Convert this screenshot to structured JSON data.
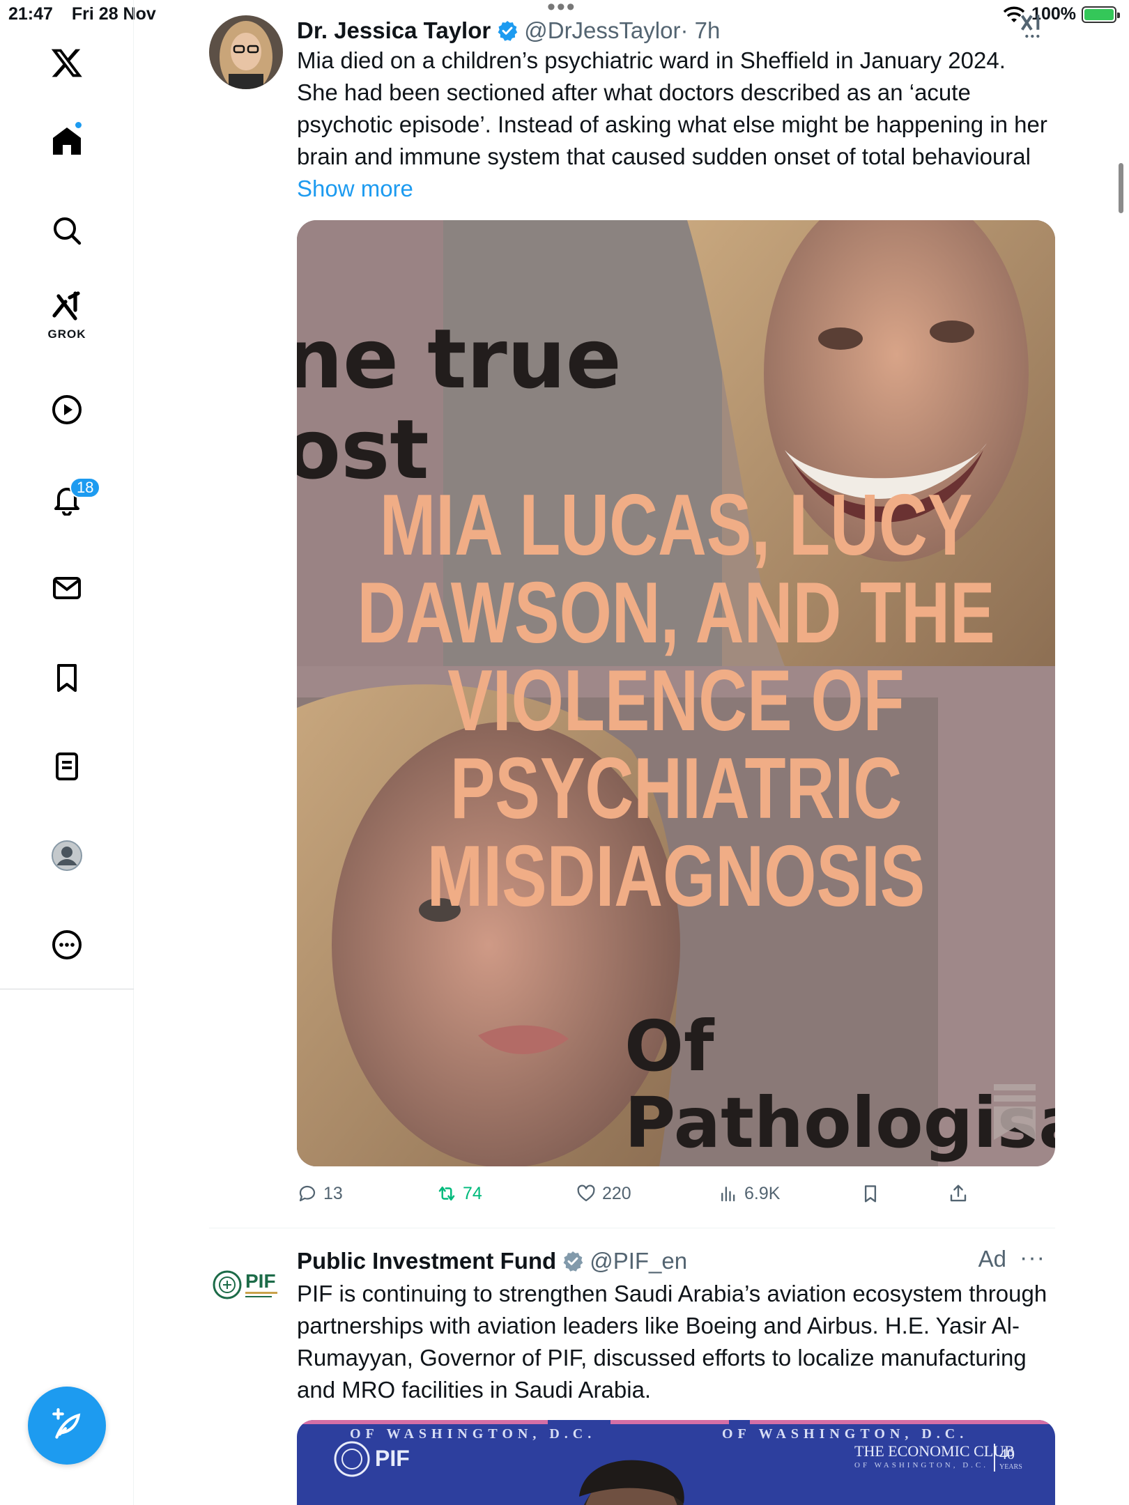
{
  "status_bar": {
    "time": "21:47",
    "date": "Fri 28 Nov",
    "battery": "100%"
  },
  "sidebar": {
    "items": [
      {
        "name": "x-logo",
        "label": ""
      },
      {
        "name": "home",
        "label": ""
      },
      {
        "name": "search",
        "label": ""
      },
      {
        "name": "grok",
        "label": "GROK"
      },
      {
        "name": "videos",
        "label": ""
      },
      {
        "name": "notifications",
        "label": ""
      },
      {
        "name": "messages",
        "label": ""
      },
      {
        "name": "bookmarks",
        "label": ""
      },
      {
        "name": "lists",
        "label": ""
      },
      {
        "name": "profile",
        "label": ""
      },
      {
        "name": "more",
        "label": ""
      }
    ],
    "notification_count": "18"
  },
  "tweets": [
    {
      "name": "Dr. Jessica Taylor",
      "handle": "@DrJessTaylor",
      "time": "· 7h",
      "text": "Mia died on a children’s psychiatric ward in Sheffield in January 2024. She had been sectioned after what doctors described as an ‘acute psychotic episode’. Instead of asking what else might be happening in her brain and immune system that caused sudden onset of total behavioural ",
      "show_more": "Show more",
      "media": {
        "bg_text_1": "ne true",
        "bg_text_2": "ost",
        "headline_lines": [
          "MIA LUCAS, LUCY",
          "DAWSON, AND THE",
          "VIOLENCE OF",
          "PSYCHIATRIC",
          "MISDIAGNOSIS"
        ],
        "bg_text_3": "Of",
        "bg_text_4": "Pathologisat"
      },
      "stats": {
        "replies": "13",
        "reposts": "74",
        "likes": "220",
        "views": "6.9K"
      }
    },
    {
      "name": "Public Investment Fund",
      "handle": "@PIF_en",
      "ad": "Ad",
      "avatar_text": "PIF",
      "text": "PIF is continuing to strengthen Saudi Arabia’s aviation ecosystem through partnerships with aviation leaders like Boeing and Airbus. H.E. Yasir Al-Rumayyan, Governor of PIF, discussed efforts to localize manufacturing and MRO facilities in Saudi Arabia.",
      "media": {
        "banner_left": "OF WASHINGTON, D.C.",
        "banner_right": "OF WASHINGTON, D.C.",
        "pif_logo": "PIF",
        "econ_club": "THE ECONOMIC CLUB",
        "econ_sub": "OF WASHINGTON, D.C.",
        "years_num": "40",
        "years_label": "YEARS"
      }
    }
  ],
  "colors": {
    "accent": "#1d9bf0",
    "repost_green": "#00ba7c",
    "headline_peach": "#f0ad86"
  }
}
